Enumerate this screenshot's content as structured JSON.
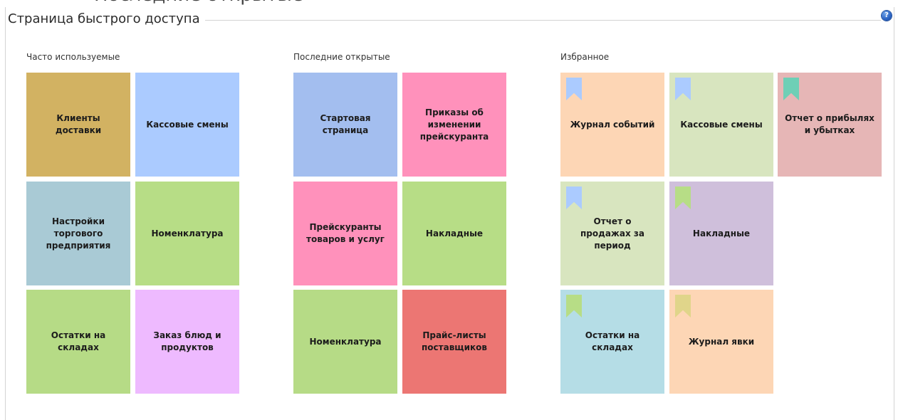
{
  "page": {
    "top_cut_text": "Последние открытые",
    "title": "Страница быстрого доступа",
    "help_glyph": "?"
  },
  "groups": {
    "frequent": {
      "label": "Часто используемые",
      "tiles": [
        {
          "label": "Клиенты доставки",
          "color": "#d2b262"
        },
        {
          "label": "Кассовые смены",
          "color": "#abcbff"
        },
        {
          "label": "Настройки торгового предприятия",
          "color": "#a9cad5"
        },
        {
          "label": "Номенклатура",
          "color": "#b7dd86"
        },
        {
          "label": "Остатки на складах",
          "color": "#b6db86"
        },
        {
          "label": "Заказ блюд и продуктов",
          "color": "#eebaff"
        }
      ]
    },
    "recent": {
      "label": "Последние открытые",
      "tiles": [
        {
          "label": "Стартовая страница",
          "color": "#a3beef"
        },
        {
          "label": "Приказы об изменении прейскуранта",
          "color": "#ff91bb"
        },
        {
          "label": "Прейскуранты товаров и услуг",
          "color": "#ff91bb"
        },
        {
          "label": "Накладные",
          "color": "#b7dd86"
        },
        {
          "label": "Номенклатура",
          "color": "#b6db86"
        },
        {
          "label": "Прайс-листы поставщиков",
          "color": "#ec7673"
        }
      ]
    },
    "favorites": {
      "label": "Избранное",
      "tiles": [
        {
          "label": "Журнал событий",
          "color": "#fdd6b5",
          "bookmark_color": "#abcbff"
        },
        {
          "label": "Кассовые смены",
          "color": "#d8e5bf",
          "bookmark_color": "#abcbff"
        },
        {
          "label": "Отчет о прибылях и убытках",
          "color": "#e6b6b6",
          "bookmark_color": "#6ecfb6"
        },
        {
          "label": "Отчет о продажах за период",
          "color": "#d8e5bf",
          "bookmark_color": "#abcbff"
        },
        {
          "label": "Накладные",
          "color": "#cfbfdb",
          "bookmark_color": "#b7dd86"
        },
        {
          "label": "Остатки на складах",
          "color": "#b5dde6",
          "bookmark_color": "#b7dd86"
        },
        {
          "label": "Журнал явки",
          "color": "#fdd6b5",
          "bookmark_color": "#e0d58a"
        }
      ]
    }
  }
}
